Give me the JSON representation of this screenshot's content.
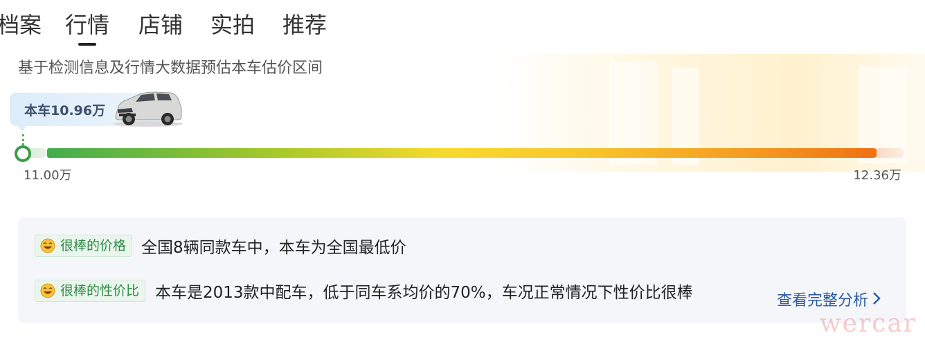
{
  "tabs": [
    {
      "label": "档案"
    },
    {
      "label": "行情"
    },
    {
      "label": "店铺"
    },
    {
      "label": "实拍"
    },
    {
      "label": "推荐"
    }
  ],
  "active_tab": "行情",
  "subtitle": "基于检测信息及行情大数据预估本车估价区间",
  "price_bubble": {
    "label": "本车10.96万"
  },
  "range": {
    "min_label": "11.00万",
    "max_label": "12.36万"
  },
  "analysis": [
    {
      "badge": "很棒的价格",
      "text": "全国8辆同款车中，本车为全国最低价"
    },
    {
      "badge": "很棒的性价比",
      "text": "本车是2013款中配车，低于同车系均价的70%，车况正常情况下性价比很棒"
    }
  ],
  "link": {
    "label": "查看完整分析",
    "icon": "chevron-right-icon"
  },
  "watermark": "wercar",
  "colors": {
    "accent_green": "#42ad4e",
    "accent_orange": "#f07014",
    "link": "#2c5aa0"
  }
}
